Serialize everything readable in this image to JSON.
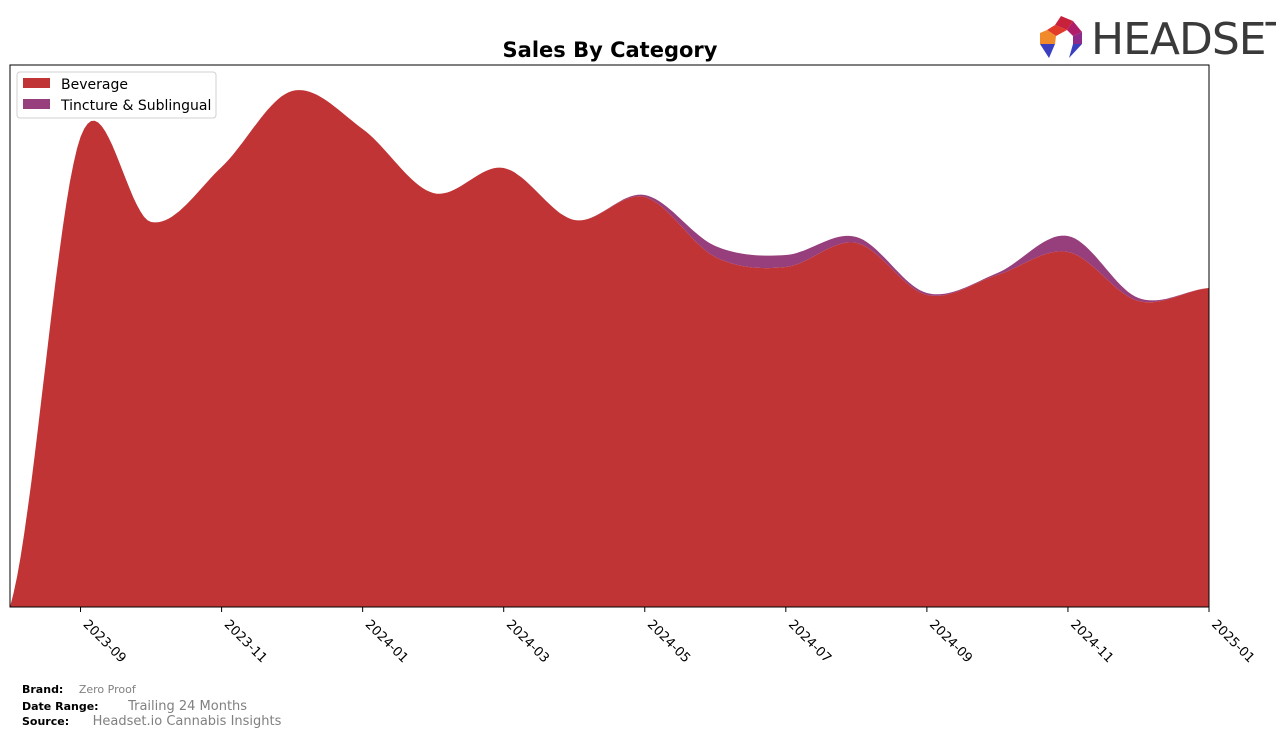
{
  "logo": {
    "text": "HEADSET",
    "icon": "headset-logo-icon"
  },
  "footer": {
    "brand_label": "Brand:",
    "brand_value": "Zero Proof",
    "date_range_label": "Date Range:",
    "date_range_value": "Trailing 24 Months",
    "source_label": "Source:",
    "source_value": "Headset.io Cannabis Insights"
  },
  "chart_data": {
    "type": "area",
    "stacked": true,
    "title": "Sales By Category",
    "xlabel": "",
    "ylabel": "",
    "y_axis_visible": false,
    "grid": false,
    "legend_position": "top-left",
    "x": [
      "2023-08",
      "2023-09",
      "2023-10",
      "2023-11",
      "2023-12",
      "2024-01",
      "2024-02",
      "2024-03",
      "2024-04",
      "2024-05",
      "2024-06",
      "2024-07",
      "2024-08",
      "2024-09",
      "2024-10",
      "2024-11",
      "2024-12",
      "2025-01"
    ],
    "tick_labels": [
      "2023-09",
      "2023-11",
      "2024-01",
      "2024-03",
      "2024-05",
      "2024-07",
      "2024-09",
      "2024-11",
      "2025-01"
    ],
    "series": [
      {
        "name": "Beverage",
        "color": "#c03435",
        "values": [
          0,
          470,
          385,
          440,
          516,
          478,
          414,
          439,
          387,
          410,
          350,
          340,
          364,
          312,
          332,
          355,
          306,
          319
        ]
      },
      {
        "name": "Tincture & Sublingual",
        "color": "#973f7c",
        "values": [
          0,
          0,
          0,
          0,
          0,
          0,
          0,
          0,
          0,
          2,
          11,
          12,
          6,
          2,
          2,
          16,
          3,
          0
        ]
      }
    ],
    "ylim": [
      0,
      542
    ]
  }
}
